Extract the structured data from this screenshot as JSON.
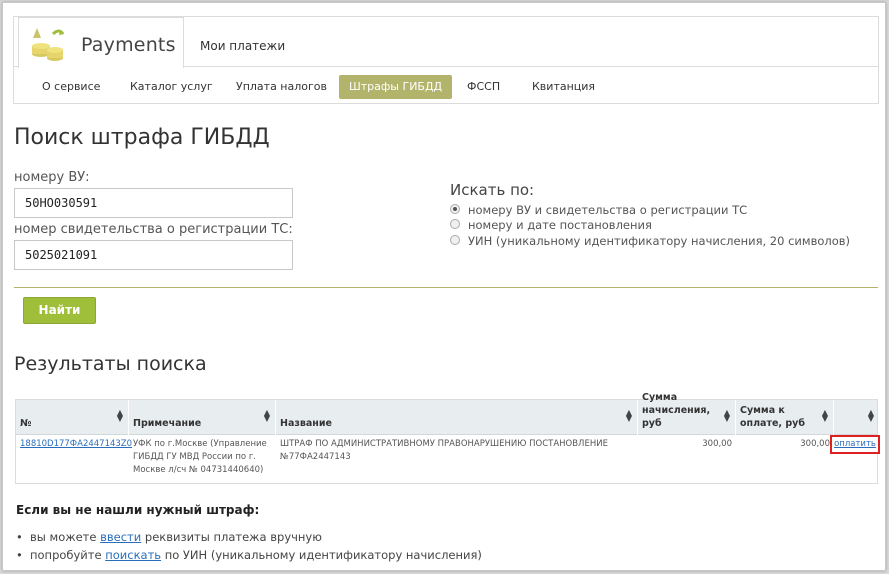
{
  "header": {
    "brand": "Payments",
    "top_link": "Мои платежи",
    "nav": [
      "О сервисе",
      "Каталог услуг",
      "Уплата налогов",
      "Штрафы ГИБДД",
      "ФССП",
      "Квитанция"
    ],
    "active_nav_index": 3,
    "accent_color": "#b2b46c"
  },
  "search": {
    "title": "Поиск штрафа ГИБДД",
    "field1_label": "номеру ВУ:",
    "field1_value": "50НО030591",
    "field2_label": "номер свидетельства о регистрации ТС:",
    "field2_value": "5025021091",
    "search_by_label": "Искать по:",
    "options": [
      "номеру ВУ и свидетельства о регистрации ТС",
      "номеру и дате постановления",
      "УИН (уникальному идентификатору начисления, 20 символов)"
    ],
    "selected_option": 0,
    "find_button": "Найти",
    "button_color": "#9fbf3b"
  },
  "results": {
    "title": "Результаты поиска",
    "columns": [
      "№",
      "Примечание",
      "Название",
      "Сумма начисления, руб",
      "Сумма к оплате, руб",
      ""
    ],
    "rows": [
      {
        "number": "18810D177ФА2447143Z0",
        "note": "УФК по г.Москве (Управление ГИБДД ГУ МВД России по г. Москве л/сч № 04731440640)",
        "name": "ШТРАФ ПО АДМИНИСТРАТИВНОМУ ПРАВОНАРУШЕНИЮ ПОСТАНОВЛЕНИЕ №77ФА2447143",
        "amount": "300,00",
        "to_pay": "300,00",
        "action": "оплатить"
      }
    ]
  },
  "not_found": {
    "title": "Если вы не нашли нужный штраф:",
    "line1_prefix": "вы можете ",
    "line1_link": "ввести",
    "line1_suffix": " реквизиты платежа вручную",
    "line2_prefix": "попробуйте ",
    "line2_link": "поискать",
    "line2_suffix": " по УИН (уникальному идентификатору начисления)"
  }
}
